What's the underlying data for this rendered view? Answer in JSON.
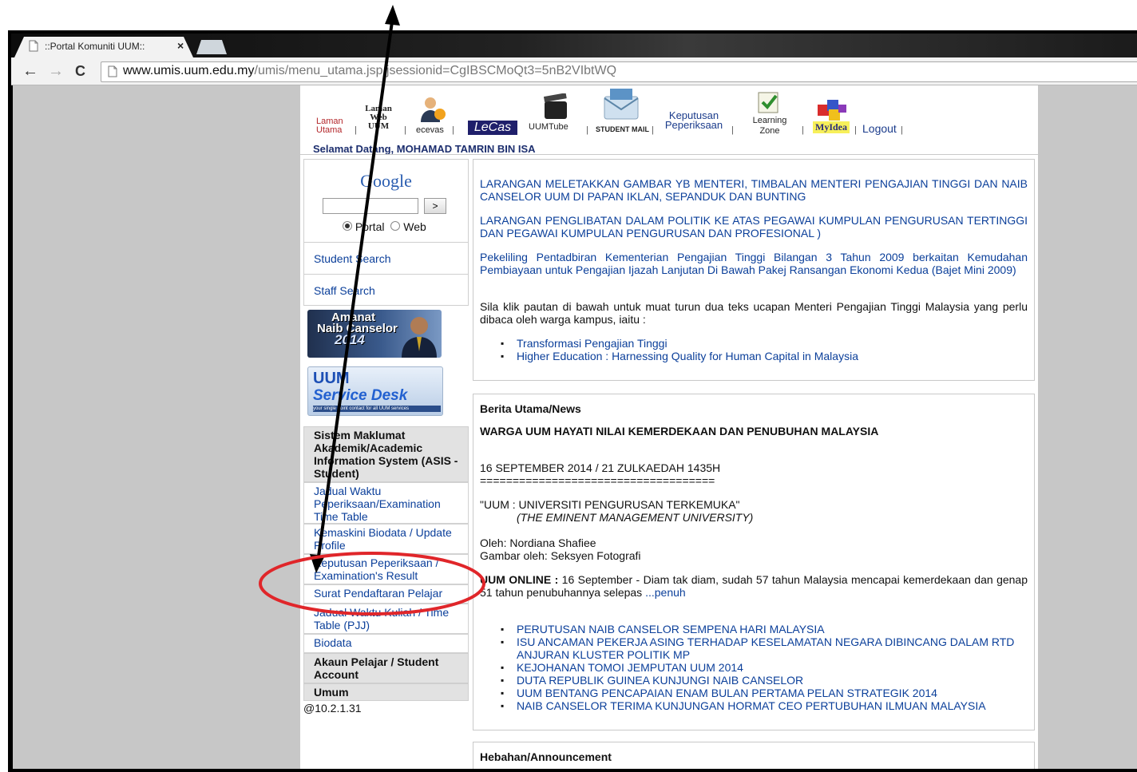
{
  "browser": {
    "tab_title": "::Portal Komuniti UUM::",
    "tab_close": "×",
    "back_glyph": "←",
    "forward_glyph": "→",
    "reload_glyph": "C",
    "url_host": "www.umis.uum.edu.my",
    "url_path": "/umis/menu_utama.jsp;jsessionid=CgIBSCMoQt3=5nB2VIbtWQ"
  },
  "header_menu": {
    "laman_utama_1": "Laman",
    "laman_utama_2": "Utama",
    "laman_web_1": "Laman",
    "laman_web_2": "Web",
    "laman_web_3": "UUM",
    "ecevas": "ecevas",
    "lecas": "LeCas",
    "uumtube": "UUMTube",
    "student_mail": "STUDENT MAIL",
    "keputusan_1": "Keputusan",
    "keputusan_2": "Peperiksaan",
    "learning_1": "Learning",
    "learning_2": "Zone",
    "myidea": "MyIdea",
    "logout": "Logout",
    "separator": "|"
  },
  "welcome": "Selamat Datang, MOHAMAD TAMRIN BIN ISA",
  "sidebar": {
    "google_logo": "Google",
    "search_button": ">",
    "radio_portal": "Portal",
    "radio_web": "Web",
    "student_search": "Student Search",
    "staff_search": "Staff Search",
    "banner_amanat_1": "Amanat",
    "banner_amanat_2": "Naib Canselor",
    "banner_amanat_3": "2014",
    "banner_service_1": "UUM",
    "banner_service_2": "Service Desk",
    "banner_service_3": "your single point contact for all UUM services",
    "asis_heading": "Sistem Maklumat Akademik/Academic Information System (ASIS - Student)",
    "items": [
      "Jadual Waktu Peperiksaan/Examination Time Table",
      "Kemaskini Biodata / Update Profile",
      "Keputusan Peperiksaan / Examination's Result",
      "Surat Pendaftaran Pelajar",
      "Jadual Waktu Kuliah / Time Table (PJJ)",
      "Biodata"
    ],
    "akaun_heading": "Akaun Pelajar / Student Account",
    "umum_heading": "Umum",
    "ip_text": "@10.2.1.31"
  },
  "notices": {
    "n1": "LARANGAN MELETAKKAN GAMBAR YB MENTERI, TIMBALAN MENTERI PENGAJIAN TINGGI DAN NAIB CANSELOR UUM DI PAPAN IKLAN, SEPANDUK DAN BUNTING",
    "n2": "LARANGAN PENGLIBATAN DALAM POLITIK KE ATAS PEGAWAI KUMPULAN PENGURUSAN TERTINGGI DAN PEGAWAI KUMPULAN PENGURUSAN DAN PROFESIONAL )",
    "n3": "Pekeliling Pentadbiran Kementerian Pengajian Tinggi Bilangan 3 Tahun 2009  berkaitan Kemudahan Pembiayaan untuk Pengajian Ijazah Lanjutan Di Bawah Pakej Ransangan Ekonomi Kedua (Bajet Mini 2009)",
    "n4": "Sila klik pautan di bawah untuk muat turun dua teks ucapan Menteri Pengajian Tinggi Malaysia yang perlu dibaca oleh warga kampus, iaitu :",
    "links": [
      "Transformasi Pengajian Tinggi",
      "Higher Education : Harnessing Quality for Human Capital in Malaysia"
    ]
  },
  "news": {
    "heading": "Berita Utama/News",
    "headline": "WARGA UUM HAYATI NILAI KEMERDEKAAN DAN PENUBUHAN MALAYSIA",
    "date": "16 SEPTEMBER 2014 / 21 ZULKAEDAH 1435H",
    "rule": "====================================",
    "quote": "\"UUM : UNIVERSITI PENGURUSAN TERKEMUKA\"",
    "quote_en": "(THE EMINENT MANAGEMENT UNIVERSITY)",
    "byline": "Oleh: Nordiana Shafiee",
    "photo": "Gambar oleh:  Seksyen Fotografi",
    "lead_bold": "UUM ONLINE :",
    "lead": " 16 September - Diam tak diam, sudah 57 tahun Malaysia mencapai kemerdekaan dan genap 51 tahun penubuhannya selepas ",
    "more": "...penuh",
    "items": [
      "PERUTUSAN NAIB CANSELOR SEMPENA HARI MALAYSIA",
      "ISU ANCAMAN PEKERJA ASING TERHADAP KESELAMATAN NEGARA DIBINCANG DALAM RTD ANJURAN KLUSTER POLITIK MP",
      "KEJOHANAN TOMOI JEMPUTAN UUM 2014",
      "DUTA REPUBLIK GUINEA KUNJUNGI NAIB CANSELOR",
      "UUM BENTANG PENCAPAIAN ENAM BULAN PERTAMA PELAN STRATEGIK 2014",
      "NAIB CANSELOR TERIMA KUNJUNGAN HORMAT CEO PERTUBUHAN ILMUAN MALAYSIA"
    ]
  },
  "announcement": {
    "heading": "Hebahan/Announcement"
  },
  "colors": {
    "link": "#0b3f9a",
    "annotation_ellipse": "#e0262a",
    "annotation_arrow": "#000000"
  }
}
